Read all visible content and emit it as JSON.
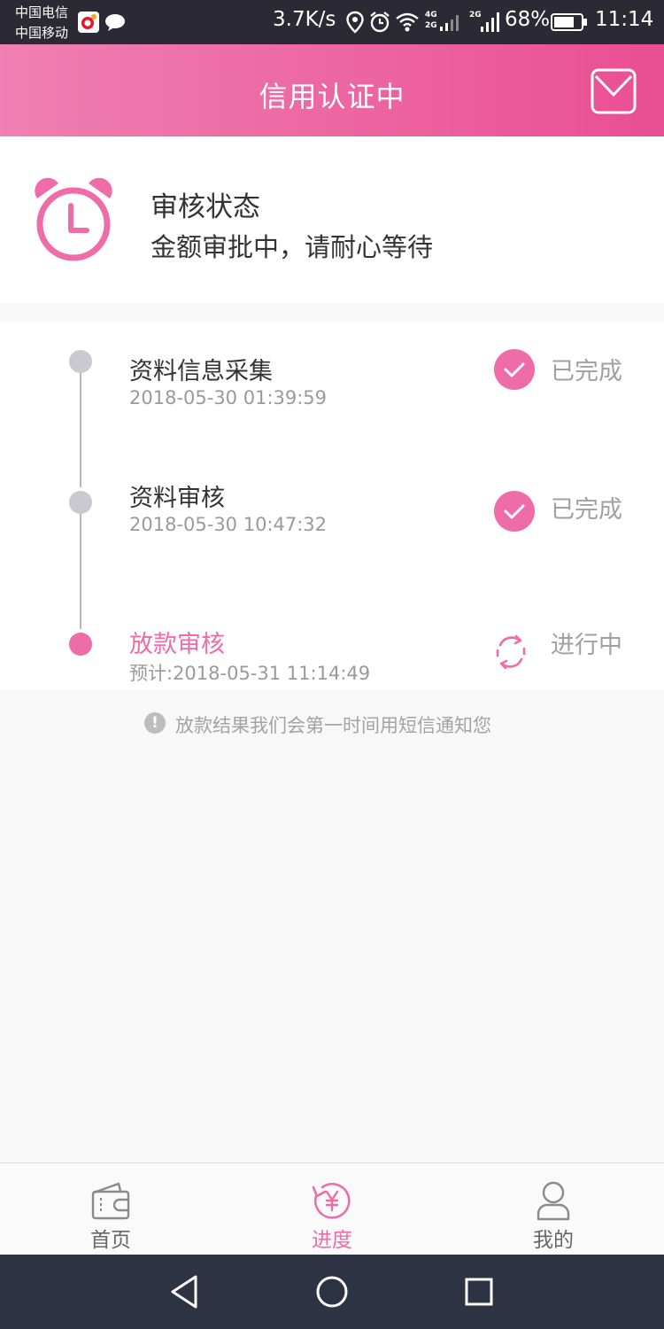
{
  "status_bar": {
    "carrier_1": "中国电信",
    "carrier_2": "中国移动",
    "speed": "3.7K/s",
    "net_top": "4G",
    "net_bottom": "2G",
    "net2": "2G",
    "battery": "68%",
    "time": "11:14"
  },
  "header": {
    "title": "信用认证中"
  },
  "review": {
    "title": "审核状态",
    "description": "金额审批中，请耐心等待"
  },
  "steps": [
    {
      "title": "资料信息采集",
      "time": "2018-05-30 01:39:59",
      "status": "已完成"
    },
    {
      "title": "资料审核",
      "time": "2018-05-30 10:47:32",
      "status": "已完成"
    },
    {
      "title": "放款审核",
      "time": "预计:2018-05-31 11:14:49",
      "status": "进行中"
    }
  ],
  "notice": {
    "icon": "!",
    "text": "放款结果我们会第一时间用短信通知您"
  },
  "tabs": [
    {
      "label": "首页",
      "icon": "wallet-icon"
    },
    {
      "label": "进度",
      "icon": "progress-yen-icon"
    },
    {
      "label": "我的",
      "icon": "user-icon"
    }
  ],
  "colors": {
    "accent": "#ee6ca8",
    "header_start": "#f07fb2",
    "header_end": "#e94f93",
    "status_bar": "#2b2a34",
    "nav_bar": "#2d3343"
  }
}
